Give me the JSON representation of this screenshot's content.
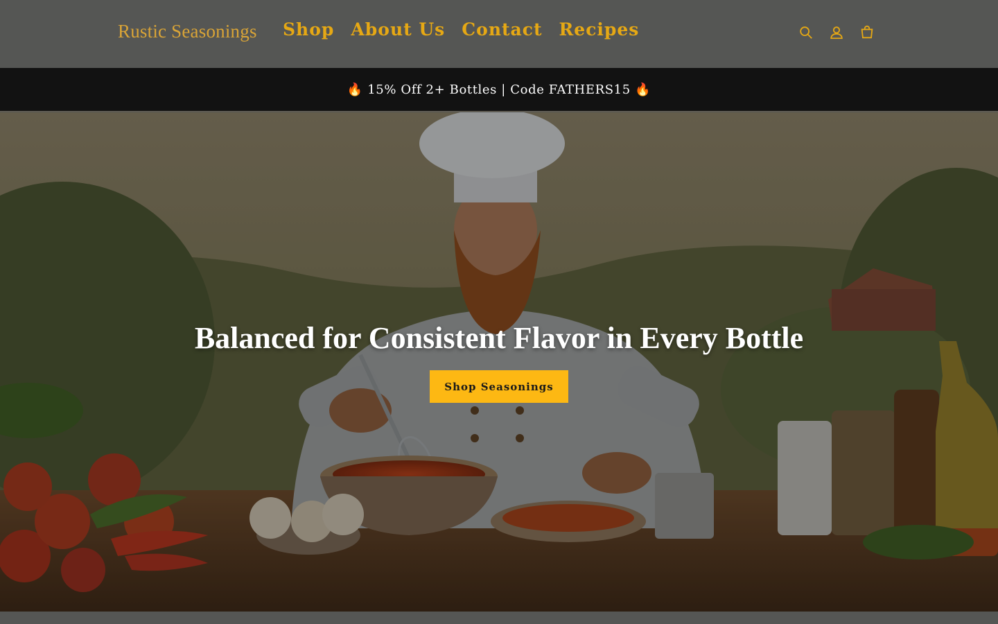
{
  "header": {
    "logo": "Rustic Seasonings",
    "nav": [
      "Shop",
      "About Us",
      "Contact",
      "Recipes"
    ],
    "icons": [
      "search-icon",
      "account-icon",
      "cart-icon"
    ]
  },
  "announcement": {
    "text": "🔥 15% Off 2+ Bottles | Code FATHERS15 🔥"
  },
  "hero": {
    "title": "Balanced for Consistent Flavor in Every Bottle",
    "button_label": "Shop Seasonings"
  },
  "colors": {
    "header_bg": "#555654",
    "nav_gold": "#e6a814",
    "announcement_bg": "#121212",
    "button_yellow": "#fdb813"
  }
}
